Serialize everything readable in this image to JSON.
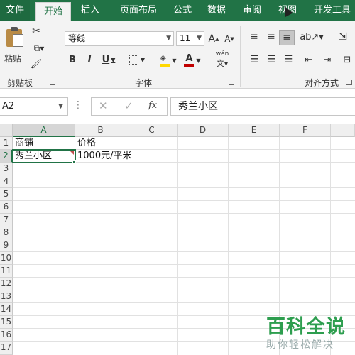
{
  "tabs": [
    {
      "label": "文件"
    },
    {
      "label": "开始"
    },
    {
      "label": "插入"
    },
    {
      "label": "页面布局"
    },
    {
      "label": "公式"
    },
    {
      "label": "数据"
    },
    {
      "label": "审阅"
    },
    {
      "label": "视图"
    },
    {
      "label": "开发工具"
    }
  ],
  "ribbon": {
    "clipboard": {
      "paste_label": "粘贴",
      "group_label": "剪贴板"
    },
    "font": {
      "font_name": "等线",
      "font_size": "11",
      "grow": "A",
      "shrink": "A",
      "bold": "B",
      "italic": "I",
      "underline": "U",
      "font_color": "A",
      "phonetic": "wén",
      "group_label": "字体"
    },
    "alignment": {
      "group_label": "对齐方式"
    }
  },
  "formula_bar": {
    "name_box": "A2",
    "fx": "fx",
    "value": "秀兰小区"
  },
  "grid": {
    "columns": [
      "A",
      "B",
      "C",
      "D",
      "E",
      "F"
    ],
    "rows": [
      "1",
      "2",
      "3",
      "4",
      "5",
      "6",
      "7",
      "8",
      "9",
      "10",
      "11",
      "12",
      "13",
      "14",
      "15",
      "16",
      "17"
    ],
    "cells": {
      "A1": "商铺",
      "B1": "价格",
      "A2": "秀兰小区",
      "B2": "1000元/平米"
    }
  },
  "watermark": {
    "title": "百科全说",
    "subtitle": "助你轻松解决"
  },
  "colors": {
    "accent": "#217346",
    "watermark": "#2e9e4f"
  }
}
